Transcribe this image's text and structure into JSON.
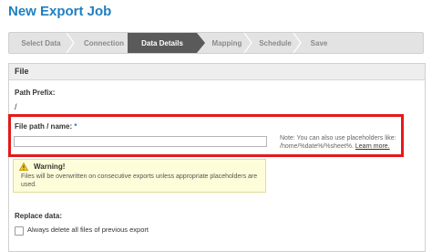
{
  "header": {
    "title": "New Export Job"
  },
  "wizard": {
    "steps": [
      {
        "label": "Select Data",
        "active": false
      },
      {
        "label": "Connection",
        "active": false
      },
      {
        "label": "Data Details",
        "active": true
      },
      {
        "label": "Mapping",
        "active": false
      },
      {
        "label": "Schedule",
        "active": false
      },
      {
        "label": "Save",
        "active": false
      }
    ]
  },
  "panel": {
    "title": "File",
    "path_prefix": {
      "label": "Path Prefix:",
      "value": "/"
    },
    "file_path": {
      "label": "File path / name:",
      "required_mark": "*",
      "value": "",
      "placeholder": "",
      "note_line1": "Note: You can also use placeholders like:",
      "note_line2": "/home/%date%/%sheet%.",
      "learn_more": "Learn more."
    },
    "warning": {
      "title": "Warning!",
      "text": "Files will be overwritten on consecutive exports unless appropriate placeholders are used."
    },
    "replace_data": {
      "label": "Replace data:",
      "checkbox_label": "Always delete all files of previous export",
      "checked": false
    }
  },
  "colors": {
    "title": "#1f7fbf",
    "active_step": "#5a5a5a",
    "highlight_border": "#e3191c",
    "warning_bg": "#fefdd9"
  }
}
